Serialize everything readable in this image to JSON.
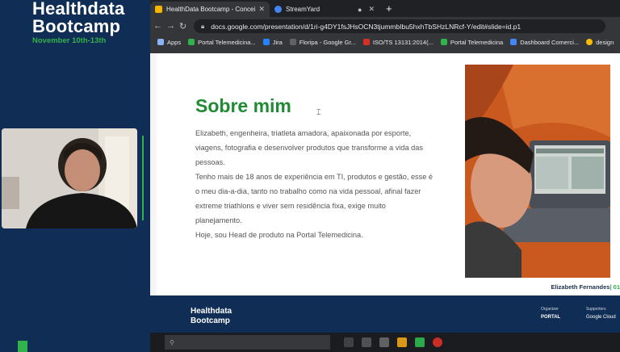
{
  "event": {
    "title_line1": "Healthdata",
    "title_line2": "Bootcamp",
    "dates": "November 10th-13th"
  },
  "browser": {
    "tabs": [
      {
        "label": "HealthData Bootcamp - Conceit",
        "active": true,
        "color": "#f4b400"
      },
      {
        "label": "StreamYard",
        "active": false,
        "color": "#4285f4"
      }
    ],
    "new_tab": "+",
    "url": "docs.google.com/presentation/d/1ri-g4DY1fsJHsOCN3tjummbIbu5hxhTbSHzLNRcf-Y/edit#slide=id.p1",
    "bookmarks": [
      {
        "label": "Apps",
        "color": "#8ab4f8"
      },
      {
        "label": "Portal Telemedicina...",
        "color": "#2fb34a"
      },
      {
        "label": "Jira",
        "color": "#2684ff"
      },
      {
        "label": "Floripa - Google Gr...",
        "color": "#5f6368"
      },
      {
        "label": "ISO/TS 13131:2014(...",
        "color": "#d93025"
      },
      {
        "label": "Portal Telemedicina",
        "color": "#2fb34a"
      },
      {
        "label": "Dashboard Comerci...",
        "color": "#4285f4"
      },
      {
        "label": "design",
        "color": "#fbbc04"
      }
    ]
  },
  "slide": {
    "title": "Sobre mim",
    "paragraphs": [
      "Elizabeth, engenheira, triatleta amadora, apaixonada por esporte, viagens, fotografia e desenvolver produtos que transforme a vida das pessoas.",
      "Tenho mais de 18 anos de experiência em TI, produtos e gestão, esse é o meu dia-a-dia, tanto no trabalho como na vida pessoal, afinal fazer extreme triathlons e viver sem residência fixa, exige muito planejamento.",
      "Hoje, sou Head de produto na Portal Telemedicina."
    ],
    "caption_name": "Elizabeth Fernandes",
    "caption_sep": "|",
    "caption_num": "01"
  },
  "footer": {
    "brand_line1": "Healthdata",
    "brand_line2": "Bootcamp",
    "organizer_label": "Organizer",
    "organizer_logo": "PORTAL",
    "supporters_label": "Supporters",
    "supporter_logo": "Google Cloud"
  },
  "colors": {
    "brand_green": "#1f8c34",
    "accent_green": "#2fb34a",
    "navy": "#0f2d55"
  }
}
